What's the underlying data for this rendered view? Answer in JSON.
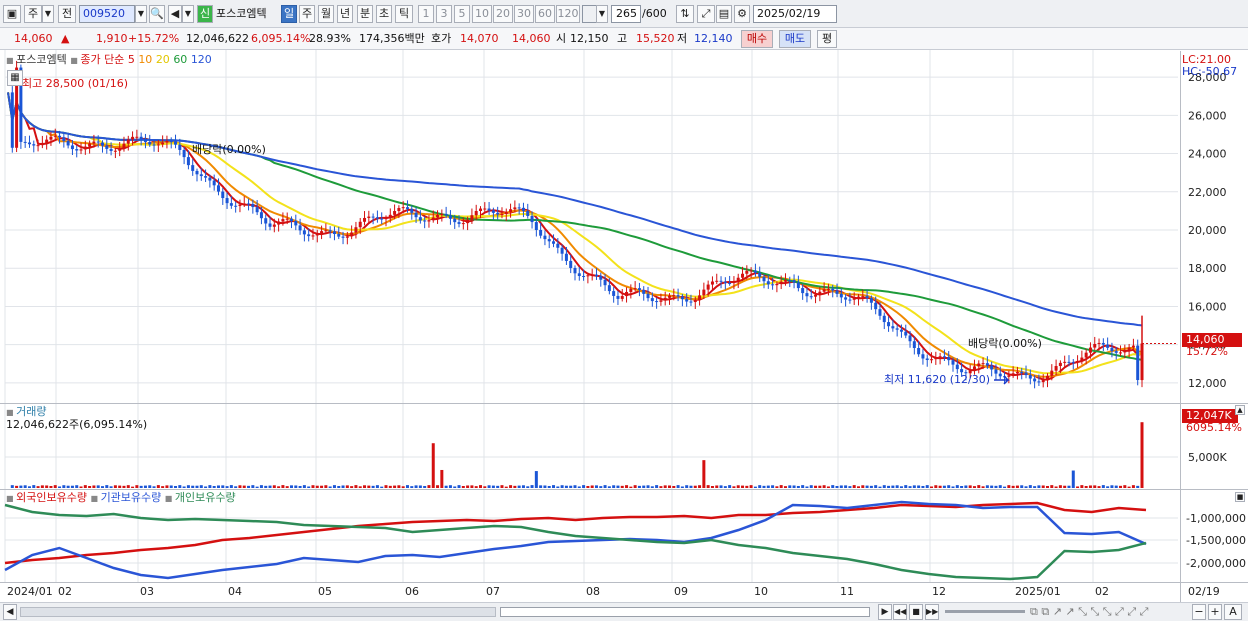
{
  "toolbar": {
    "period_label": "주",
    "compare_label": "전",
    "code_value": "009520",
    "badge_new": "신",
    "stock_name": "포스코엠텍",
    "intervals": [
      "일",
      "주",
      "월",
      "년",
      "분",
      "초",
      "틱"
    ],
    "active_interval": "일",
    "minute_steps": [
      "1",
      "3",
      "5",
      "10",
      "20",
      "30",
      "60",
      "120"
    ],
    "count_value": "265",
    "count_total": "/600",
    "date_value": "2025/02/19"
  },
  "quote": {
    "price": "14,060",
    "change_arrow": "▲",
    "change": "1,910",
    "change_pct": "+15.72%",
    "volume": "12,046,622",
    "volume_pct": "6,095.14%",
    "turnover": "28.93%",
    "amount": "174,356백만",
    "hoga_label": "호가",
    "ask": "14,070",
    "bid": "14,060",
    "open_label": "시",
    "open": "12,150",
    "high_label": "고",
    "high": "15,520",
    "low_label": "저",
    "low": "12,140",
    "buy_label": "매수",
    "sell_label": "매도",
    "avg_label": "평"
  },
  "price_panel": {
    "name": "포스코엠텍",
    "legend_prefix": "종가 단순",
    "ma_periods": [
      "5",
      "10",
      "20",
      "60",
      "120"
    ],
    "ma_colors": [
      "#d41010",
      "#f08a00",
      "#f3e21b",
      "#1e9b3a",
      "#2a55d6"
    ],
    "lc_label": "LC:21.00",
    "hc_label": "HC:-50.67",
    "high_note": "최고 28,500 (01/16)",
    "low_note": "최저 11,620 (12/30)",
    "dividend_note_1": "배당락(0.00%)",
    "dividend_note_2": "배당락(0.00%)",
    "current_price_tag": "14,060",
    "current_pct_tag": "15.72%",
    "y_ticks": [
      "28,000",
      "26,000",
      "24,000",
      "22,000",
      "20,000",
      "18,000",
      "16,000",
      "14,000",
      "12,000"
    ]
  },
  "volume_panel": {
    "title": "거래량",
    "value_line": "12,046,622주(6,095.14%)",
    "tag_value": "12,047K",
    "tag_pct": "6095.14%",
    "y_ticks": [
      "5,000K"
    ]
  },
  "holding_panel": {
    "legend": [
      "외국인보유수량",
      "기관보유수량",
      "개인보유수량"
    ],
    "legend_colors": [
      "#d41010",
      "#2a55d6",
      "#2e8b57"
    ],
    "y_ticks": [
      "-1,000,000",
      "-1,500,000",
      "-2,000,000"
    ]
  },
  "x_axis": {
    "labels": [
      "2024/01",
      "02",
      "03",
      "04",
      "05",
      "06",
      "07",
      "08",
      "09",
      "10",
      "11",
      "12",
      "2025/01",
      "02"
    ],
    "right_label": "02/19"
  },
  "nav": {
    "zoom_out": "−",
    "zoom_in": "+",
    "text_tool": "A"
  },
  "chart_data": {
    "type": "candlestick",
    "title": "포스코엠텍",
    "x_range": [
      "2024/01",
      "2025/02/19"
    ],
    "ylim": [
      11000,
      29000
    ],
    "approx_close_by_month": [
      {
        "month": "2024/01",
        "close": 24000
      },
      {
        "month": "02",
        "close": 24800
      },
      {
        "month": "03",
        "close": 24000
      },
      {
        "month": "04",
        "close": 20000
      },
      {
        "month": "05",
        "close": 20200
      },
      {
        "month": "06",
        "close": 21000
      },
      {
        "month": "07",
        "close": 20500
      },
      {
        "month": "08",
        "close": 16200
      },
      {
        "month": "09",
        "close": 17000
      },
      {
        "month": "10",
        "close": 17500
      },
      {
        "month": "11",
        "close": 15500
      },
      {
        "month": "12",
        "close": 12300
      },
      {
        "month": "2025/01",
        "close": 12800
      },
      {
        "month": "02",
        "close": 14060
      }
    ],
    "high": {
      "value": 28500,
      "date": "01/16"
    },
    "low": {
      "value": 11620,
      "date": "12/30"
    }
  }
}
